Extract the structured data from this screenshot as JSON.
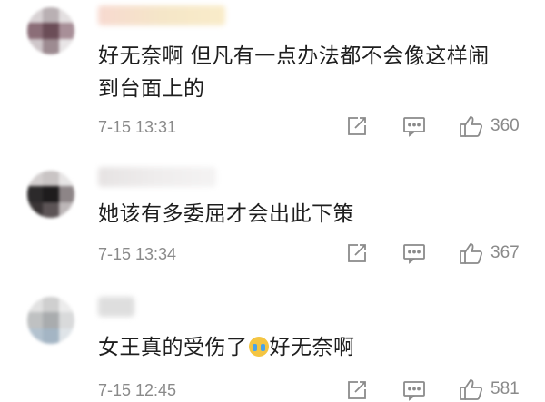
{
  "comments": [
    {
      "text_line1": "好无奈啊 但凡有一点办法都不会像这样闹",
      "text_line2": "到台面上的",
      "time": "7-15 13:31",
      "likes": "360"
    },
    {
      "text_line1": "她该有多委屈才会出此下策",
      "time": "7-15 13:34",
      "likes": "367"
    },
    {
      "text_before_emoji": "女王真的受伤了",
      "emoji": "crying-face-emoji",
      "text_after_emoji": "好无奈啊",
      "time": "7-15 12:45",
      "likes": "581"
    }
  ],
  "icons": {
    "repost": "share-icon",
    "comment": "comment-icon",
    "like": "thumbs-up-icon"
  },
  "colors": {
    "meta_gray": "#8a8a8a",
    "text": "#1e1e1e"
  }
}
